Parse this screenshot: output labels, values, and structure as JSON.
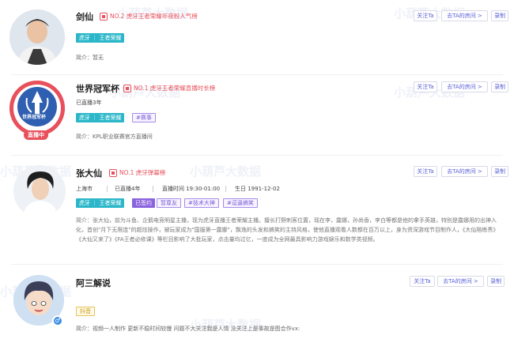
{
  "streamers": [
    {
      "name": "剑仙",
      "rank": "NO.2 虎牙王者荣耀年夜粉人气榜",
      "platform_tag": "虎牙 ｜ 王者荣耀",
      "intro": "简介：暂无",
      "buttons": {
        "follow": "关注Ta",
        "room": "去TA的房间 >",
        "record": "录制"
      }
    },
    {
      "name": "世界冠军杯",
      "rank": "NO.1 虎牙王者荣耀直播时长榜",
      "live_time": "已直播3年",
      "platform_tag": "虎牙 ｜ 王者荣耀",
      "extra_tag": "#赛事",
      "avatar_text": "世界冠军杯",
      "live_badge": "直播中",
      "intro": "简介：KPL职业联赛官方直播间",
      "buttons": {
        "follow": "关注Ta",
        "room": "去TA的房间 >",
        "record": "录制"
      }
    },
    {
      "name": "张大仙",
      "rank": "NO.1 虎牙弹幕榜",
      "meta": {
        "city": "上海市",
        "live_time": "已直播4年",
        "schedule": "直播时间 19:30-01:00",
        "birthday": "生日 1991-12-02"
      },
      "platform_tag": "虎牙 ｜ 王者荣耀",
      "signed_tag": "已签约",
      "fan_tag": "暂尊友",
      "extra_tags": [
        "#技术大神",
        "#逗逼搞笑"
      ],
      "intro": "简介：张大仙，前为斗鱼、企鹅电竞明星主播，现为虎牙直播王者荣耀主播。擅长打野刺客位置，瑶在李，露娜，孙尚香，李白等都是他的拿手英雄，特别是露娜用的出神入化，首创\"月下无限连\"的超炫操作，被玩家成为\"国服第一露娜\"，飘逸的头发和搞笑的主持风格，使他直播观看人数都在百万以上，身为资深游戏节目制作人，《大仙陪练秀》《大仙又来了》《FA王者必修课》等栏目影响了大批玩家，点击量均过亿，一度成为全网最具影响力游戏娱乐和数学类视频。",
      "buttons": {
        "follow": "关注Ta",
        "room": "去TA的房间 >",
        "record": "录制"
      }
    },
    {
      "name": "阿三解说",
      "platform_tag": "抖音",
      "gender_icon": "♂",
      "intro": "简介：视频一人制作 更新不稳时间较慢 问题不大关注我是人情 没关注上是事故是图合作vx:",
      "buttons": {
        "follow": "关注Ta",
        "room": "去TA的房间 >",
        "record": "录制"
      }
    }
  ],
  "watermarks": [
    "小葫芦大数据",
    "小葫芦大数据",
    "小葫芦大数据",
    "小葫芦大数据",
    "小葫芦大数据",
    "小葫芦大数据",
    "小葫芦大数据",
    "小葫芦大数据"
  ],
  "colors": {
    "accent": "#5b61d6",
    "rank": "#e8505b",
    "teal": "#2bb7c9",
    "purple": "#8a63de"
  }
}
